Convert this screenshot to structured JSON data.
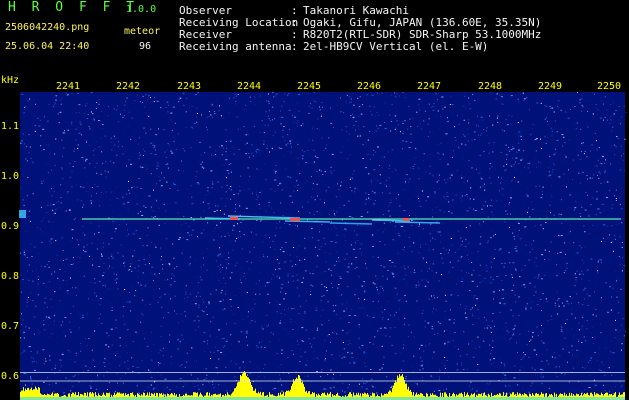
{
  "header": {
    "app_name": "H R O F F T",
    "version": "1.0.0",
    "filename": "2506042240.png",
    "datetime": "25.06.04 22:40",
    "meteor_label": "meteor",
    "meteor_count": "96",
    "info": [
      {
        "label": "Observer",
        "value": "Takanori Kawachi"
      },
      {
        "label": "Receiving Location",
        "value": "Ogaki, Gifu, JAPAN (136.60E, 35.35N)"
      },
      {
        "label": "Receiver",
        "value": "R820T2(RTL-SDR) SDR-Sharp 53.1000MHz"
      },
      {
        "label": "Receiving antenna",
        "value": "2el-HB9CV Vertical (el. E-W)"
      }
    ]
  },
  "plot": {
    "y_axis_unit": "kHz",
    "y_ticks": [
      "1.1",
      "1.0",
      "0.9",
      "0.8",
      "0.7",
      "0.6"
    ],
    "x_ticks": [
      "2241",
      "2242",
      "2243",
      "2244",
      "2245",
      "2246",
      "2247",
      "2248",
      "2249",
      "2250"
    ],
    "colors": {
      "background": "#000000",
      "noise_low": "#00127a",
      "noise_high": "#1e6cff",
      "carrier": "#55f0b0",
      "echo": "#ff4a4a",
      "signal_bar": "#ffff00",
      "axis_label": "#ffff00"
    }
  }
}
